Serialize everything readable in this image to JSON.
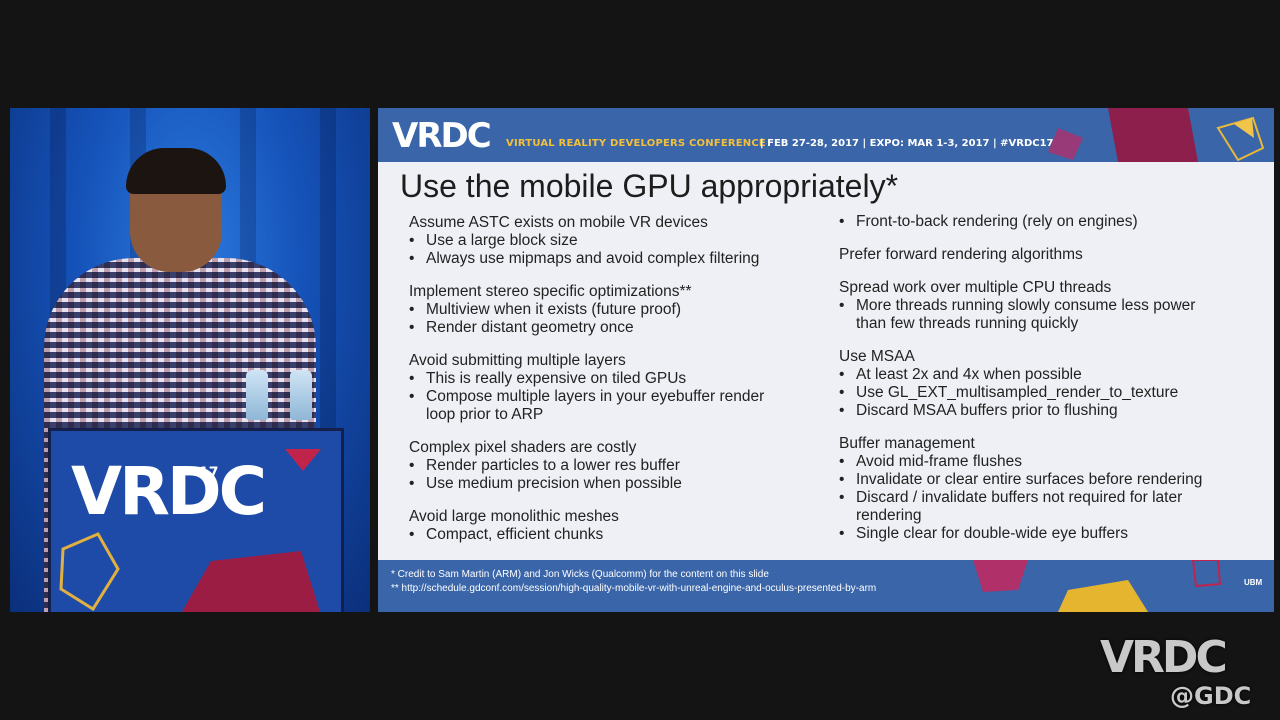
{
  "podium": {
    "logo_text": "VRDC",
    "logo_badge": "17"
  },
  "slide": {
    "header": {
      "logo": "VRDC",
      "conference": "VIRTUAL REALITY DEVELOPERS CONFERENCE",
      "dates": "| FEB 27-28, 2017 | EXPO: MAR 1-3, 2017 | #VRDC17"
    },
    "title": "Use the mobile GPU appropriately*",
    "left_sections": [
      {
        "title": "Assume ASTC exists on mobile VR devices",
        "bullets": [
          "Use a large block size",
          "Always use mipmaps and avoid complex filtering"
        ]
      },
      {
        "title": "Implement stereo specific optimizations**",
        "bullets": [
          "Multiview when it exists (future proof)",
          "Render distant geometry once"
        ]
      },
      {
        "title": "Avoid submitting multiple layers",
        "bullets": [
          "This is really expensive on tiled GPUs",
          "Compose multiple layers in your eyebuffer render",
          "loop prior to ARP"
        ]
      },
      {
        "title": "Complex pixel shaders are costly",
        "bullets": [
          "Render particles to a lower res buffer",
          "Use medium precision when possible"
        ]
      },
      {
        "title": "Avoid large monolithic meshes",
        "bullets": [
          "Compact, efficient chunks"
        ]
      }
    ],
    "right_sections": [
      {
        "title": "",
        "bullets": [
          "Front-to-back rendering (rely on engines)"
        ]
      },
      {
        "title": "Prefer forward rendering algorithms",
        "bullets": []
      },
      {
        "title": "Spread work over multiple CPU threads",
        "bullets": [
          "More threads running slowly consume less power",
          "than few threads running quickly"
        ]
      },
      {
        "title": "Use MSAA",
        "bullets": [
          "At least 2x and 4x when possible",
          "Use GL_EXT_multisampled_render_to_texture",
          "Discard MSAA buffers prior to flushing"
        ]
      },
      {
        "title": "Buffer management",
        "bullets": [
          "Avoid mid-frame flushes",
          "Invalidate or clear entire surfaces before rendering",
          "Discard / invalidate buffers not required for later",
          "rendering",
          "Single clear for double-wide eye buffers"
        ]
      }
    ],
    "footnote_1": "* Credit to Sam Martin (ARM) and Jon Wicks (Qualcomm) for the content on this slide",
    "footnote_2": "** http://schedule.gdconf.com/session/high-quality-mobile-vr-with-unreal-engine-and-oculus-presented-by-arm",
    "footer_brand": "UBM"
  },
  "watermark": {
    "text": "VRDC",
    "sub": "@GDC"
  },
  "colors": {
    "slide_band": "#3a65a9",
    "accent_gold": "#f3c03a",
    "stage_blue": "#1552b8"
  }
}
